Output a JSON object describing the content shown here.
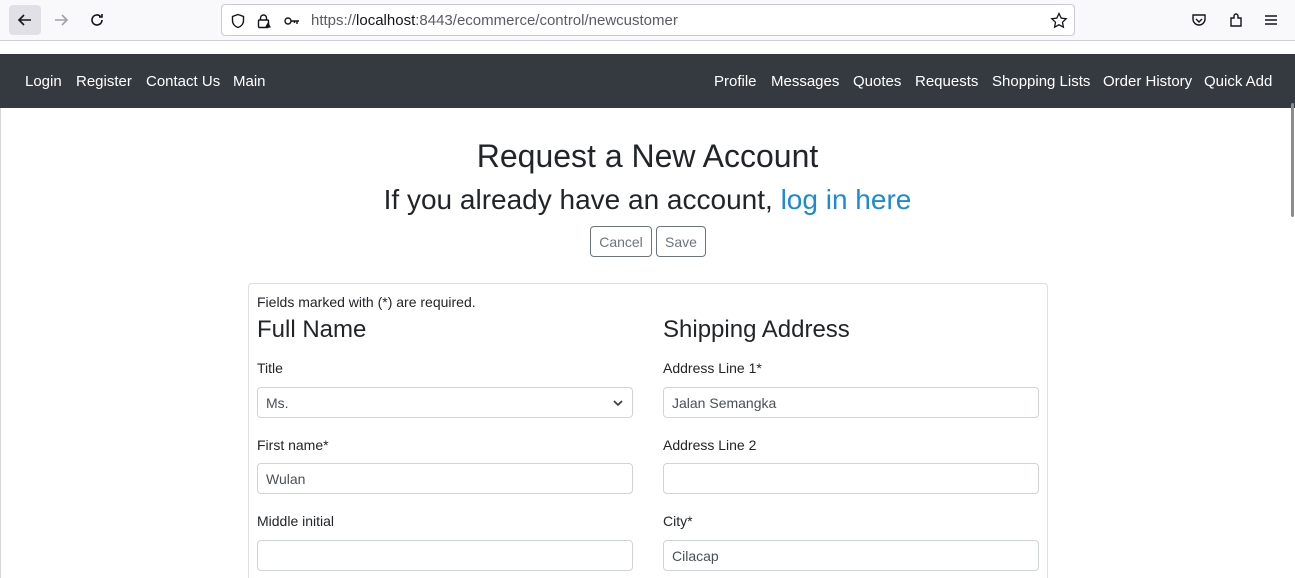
{
  "browser": {
    "url_prefix": "https://",
    "url_host": "localhost",
    "url_path": ":8443/ecommerce/control/newcustomer",
    "icons": [
      "back-arrow-icon",
      "forward-arrow-icon",
      "reload-icon",
      "shield-icon",
      "lock-warning-icon",
      "key-icon",
      "star-icon",
      "pocket-icon",
      "extensions-icon",
      "menu-icon"
    ]
  },
  "nav": {
    "left": [
      "Login",
      "Register",
      "Contact Us",
      "Main"
    ],
    "right": [
      "Profile",
      "Messages",
      "Quotes",
      "Requests",
      "Shopping Lists",
      "Order History",
      "Quick Add"
    ]
  },
  "page": {
    "title": "Request a New Account",
    "subtitle_prefix": "If you already have an account,",
    "login_link": "log in here",
    "cancel_label": "Cancel",
    "save_label": "Save"
  },
  "form": {
    "required_note": "Fields marked with (*) are required.",
    "full_name": {
      "heading": "Full Name",
      "title_label": "Title",
      "title_value": "Ms.",
      "first_name_label": "First name*",
      "first_name_value": "Wulan",
      "middle_initial_label": "Middle initial",
      "middle_initial_value": ""
    },
    "shipping": {
      "heading": "Shipping Address",
      "address1_label": "Address Line 1*",
      "address1_value": "Jalan Semangka",
      "address2_label": "Address Line 2",
      "address2_value": "",
      "city_label": "City*",
      "city_value": "Cilacap"
    }
  },
  "colors": {
    "navbar_bg": "#343a40",
    "link": "#1b8ad8",
    "button_border": "#6c757d"
  }
}
